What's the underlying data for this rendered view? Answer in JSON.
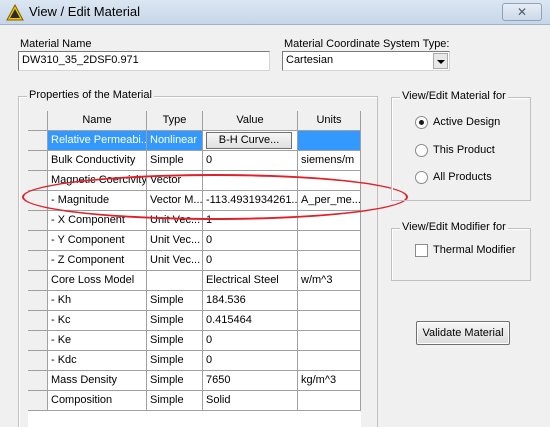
{
  "window": {
    "title": "View / Edit Material",
    "close_glyph": "✕"
  },
  "material_name": {
    "label": "Material Name",
    "value": "DW310_35_2DSF0.971"
  },
  "coord_system": {
    "label": "Material Coordinate System Type:",
    "value": "Cartesian"
  },
  "properties": {
    "legend": "Properties of the Material",
    "columns": [
      "Name",
      "Type",
      "Value",
      "Units"
    ],
    "rows": [
      {
        "name": "Relative Permeabi...",
        "type": "Nonlinear",
        "value": "B-H Curve...",
        "units": ""
      },
      {
        "name": "Bulk Conductivity",
        "type": "Simple",
        "value": "0",
        "units": "siemens/m"
      },
      {
        "name": "Magnetic Coercivity",
        "type": "Vector",
        "value": "",
        "units": ""
      },
      {
        "name": "- Magnitude",
        "type": "Vector M...",
        "value": "-113.4931934261...",
        "units": "A_per_me..."
      },
      {
        "name": "- X Component",
        "type": "Unit Vec...",
        "value": "1",
        "units": ""
      },
      {
        "name": "- Y Component",
        "type": "Unit Vec...",
        "value": "0",
        "units": ""
      },
      {
        "name": "- Z Component",
        "type": "Unit Vec...",
        "value": "0",
        "units": ""
      },
      {
        "name": "Core Loss Model",
        "type": "",
        "value": "Electrical Steel",
        "units": "w/m^3"
      },
      {
        "name": "- Kh",
        "type": "Simple",
        "value": "184.536",
        "units": ""
      },
      {
        "name": "- Kc",
        "type": "Simple",
        "value": "0.415464",
        "units": ""
      },
      {
        "name": "- Ke",
        "type": "Simple",
        "value": "0",
        "units": ""
      },
      {
        "name": "- Kdc",
        "type": "Simple",
        "value": "0",
        "units": ""
      },
      {
        "name": "Mass Density",
        "type": "Simple",
        "value": "7650",
        "units": "kg/m^3"
      },
      {
        "name": "Composition",
        "type": "Simple",
        "value": "Solid",
        "units": ""
      }
    ]
  },
  "view_edit_for": {
    "legend": "View/Edit Material for",
    "options": [
      "Active Design",
      "This Product",
      "All Products"
    ],
    "selected": "Active Design"
  },
  "modifier": {
    "legend": "View/Edit Modifier for",
    "thermal_label": "Thermal Modifier",
    "thermal_checked": false
  },
  "validate_button": "Validate Material",
  "colors": {
    "selection": "#3399ff",
    "annotation": "#e0202a",
    "titlebar": "#c7d6e8"
  }
}
